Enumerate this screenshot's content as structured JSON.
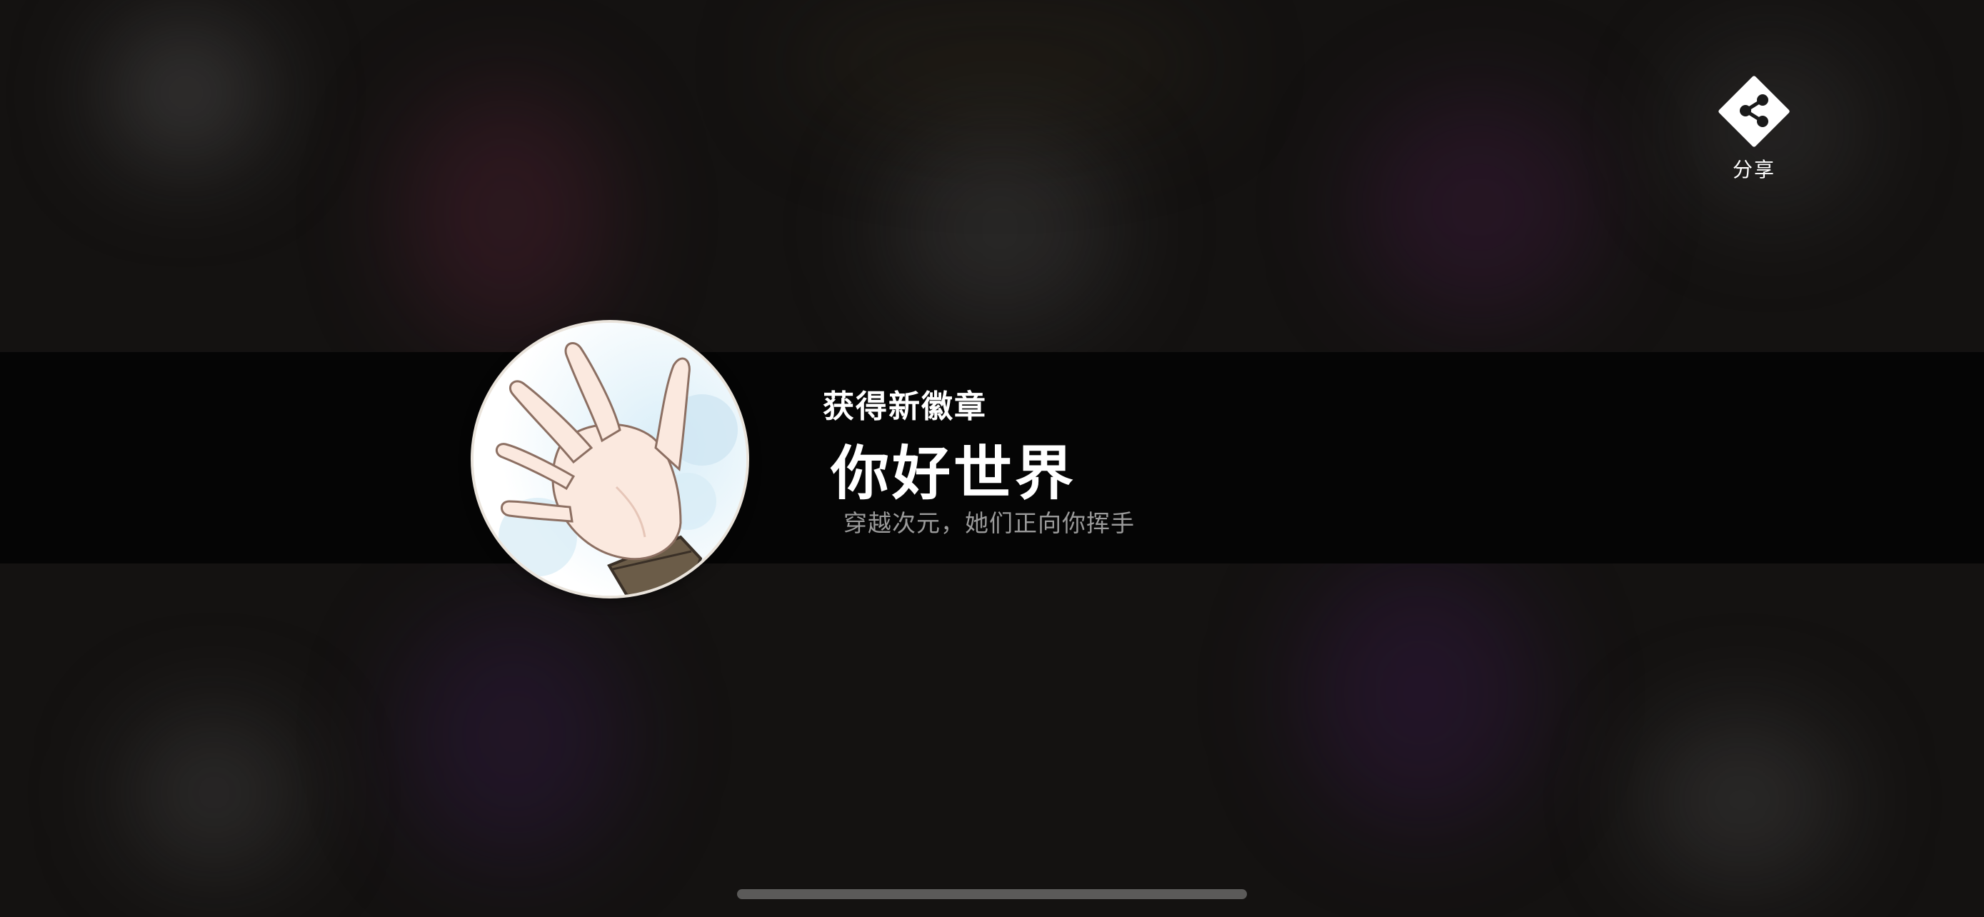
{
  "share": {
    "label": "分享",
    "icon": "share-icon"
  },
  "badge": {
    "eyebrow": "获得新徽章",
    "name": "你好世界",
    "description": "穿越次元，她们正向你挥手",
    "icon": "waving-hand-icon"
  },
  "colors": {
    "banner": "#050505",
    "background": "#141211",
    "title": "#ffffff",
    "subtitle": "#9a9a9a",
    "home_indicator": "#5b5a59"
  }
}
